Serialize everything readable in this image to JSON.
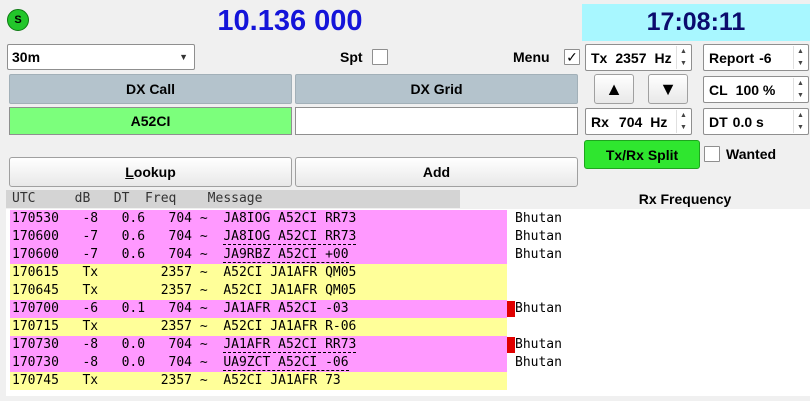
{
  "status_led": {
    "label": "S",
    "color": "#22c62a"
  },
  "dial_frequency": "10.136 000",
  "clock": "17:08:11",
  "band": {
    "value": "30m"
  },
  "spt_label": "Spt",
  "menu_label": "Menu",
  "menu_checked": "✓",
  "tx_freq": {
    "label": "Tx",
    "value": "2357",
    "unit": "Hz"
  },
  "rx_freq": {
    "label": "Rx",
    "value": "704",
    "unit": "Hz"
  },
  "report": {
    "label": "Report",
    "value": "-6"
  },
  "cl": {
    "label": "CL",
    "value": "100 %"
  },
  "dt": {
    "label": "DT",
    "value": "0.0 s"
  },
  "dx_call": {
    "header": "DX Call",
    "value": "A52CI"
  },
  "dx_grid": {
    "header": "DX Grid",
    "value": ""
  },
  "lookup_label": "Lookup",
  "add_label": "Add",
  "tx_rx_split_label": "Tx/Rx Split",
  "wanted_label": "Wanted",
  "decode_header": "UTC     dB   DT  Freq    Message",
  "rx_frequency_title": "Rx Frequency",
  "decodes": [
    {
      "utc": "170530",
      "db": "-8",
      "dt": "0.6",
      "freq": "704",
      "message": "JA8IOG A52CI RR73",
      "country": "Bhutan",
      "kind": "rx"
    },
    {
      "utc": "170600",
      "db": "-7",
      "dt": "0.6",
      "freq": "704",
      "message": "JA8IOG A52CI RR73",
      "country": "Bhutan",
      "kind": "rx"
    },
    {
      "utc": "170600",
      "db": "-7",
      "dt": "0.6",
      "freq": "704",
      "message": "JA9RBZ A52CI +00",
      "country": "Bhutan",
      "kind": "rx"
    },
    {
      "utc": "170615",
      "db": "Tx",
      "dt": "",
      "freq": "2357",
      "message": "A52CI JA1AFR QM05",
      "country": "",
      "kind": "tx"
    },
    {
      "utc": "170645",
      "db": "Tx",
      "dt": "",
      "freq": "2357",
      "message": "A52CI JA1AFR QM05",
      "country": "",
      "kind": "tx"
    },
    {
      "utc": "170700",
      "db": "-6",
      "dt": "0.1",
      "freq": "704",
      "message": "JA1AFR A52CI -03",
      "country": "Bhutan",
      "kind": "rx"
    },
    {
      "utc": "170715",
      "db": "Tx",
      "dt": "",
      "freq": "2357",
      "message": "A52CI JA1AFR R-06",
      "country": "",
      "kind": "tx"
    },
    {
      "utc": "170730",
      "db": "-8",
      "dt": "0.0",
      "freq": "704",
      "message": "JA1AFR A52CI RR73",
      "country": "Bhutan",
      "kind": "rx"
    },
    {
      "utc": "170730",
      "db": "-8",
      "dt": "0.0",
      "freq": "704",
      "message": "UA9ZCT A52CI -06",
      "country": "Bhutan",
      "kind": "rx"
    },
    {
      "utc": "170745",
      "db": "Tx",
      "dt": "",
      "freq": "2357",
      "message": "A52CI JA1AFR 73",
      "country": "",
      "kind": "tx"
    }
  ],
  "colors": {
    "rx_row": "#ff99ff",
    "tx_row": "#ffff99",
    "dx_call_bg": "#7cff7c",
    "split_bg": "#2fe62f",
    "freq_text": "#1414d9",
    "clock_bg": "#a8f7ff"
  }
}
